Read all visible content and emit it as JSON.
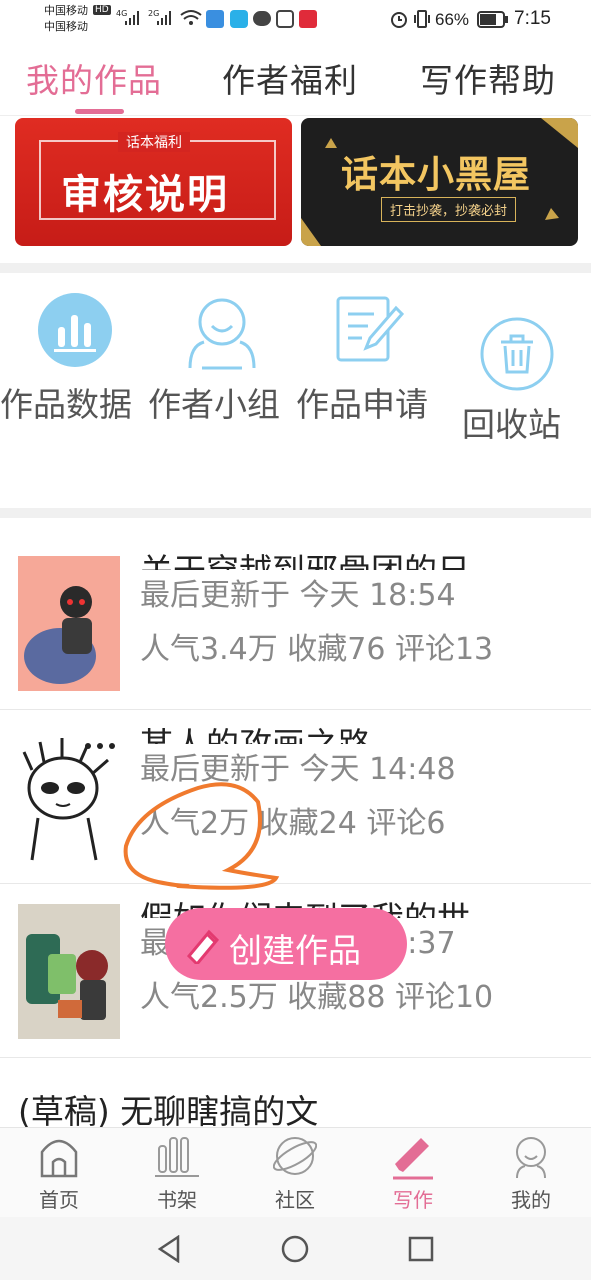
{
  "status_bar": {
    "carrier1": "中国移动",
    "carrier2": "中国移动",
    "hd": "HD",
    "net1": "4G",
    "net2": "2G",
    "battery": "66%",
    "time": "7:15"
  },
  "tabs": [
    {
      "label": "我的作品",
      "active": true
    },
    {
      "label": "作者福利",
      "active": false
    },
    {
      "label": "写作帮助",
      "active": false
    }
  ],
  "banners": {
    "left": {
      "small": "话本福利",
      "big": "审核说明"
    },
    "right": {
      "big": "话本小黑屋",
      "small": "打击抄袭，抄袭必封"
    }
  },
  "tools": [
    {
      "label": "作品数据",
      "icon": "chart-icon"
    },
    {
      "label": "作者小组",
      "icon": "group-icon"
    },
    {
      "label": "作品申请",
      "icon": "edit-doc-icon"
    },
    {
      "label": "回收站",
      "icon": "trash-icon"
    }
  ],
  "works": [
    {
      "title": "关于穿越到邪骨团的日",
      "updated": "最后更新于 今天 18:54",
      "stats": "人气3.4万 收藏76 评论13"
    },
    {
      "title": "某人的孜画之路",
      "updated": "最后更新于 今天 14:48",
      "stats": "人气2万 收藏24 评论6"
    },
    {
      "title": "假如你们来到了我的世",
      "updated": "最后更新于 今天 14:37",
      "stats": "人气2.5万 收藏88 评论10"
    }
  ],
  "draft": {
    "title": "(草稿) 无聊瞎搞的文"
  },
  "fab": {
    "label": "创建作品"
  },
  "bottom_nav": [
    {
      "label": "首页",
      "icon": "home-icon"
    },
    {
      "label": "书架",
      "icon": "bookshelf-icon"
    },
    {
      "label": "社区",
      "icon": "planet-icon"
    },
    {
      "label": "写作",
      "icon": "pen-icon",
      "active": true
    },
    {
      "label": "我的",
      "icon": "profile-icon"
    }
  ],
  "colors": {
    "accent": "#e36d95",
    "fab": "#f56fa1",
    "icon_blue": "#8dcff0"
  }
}
